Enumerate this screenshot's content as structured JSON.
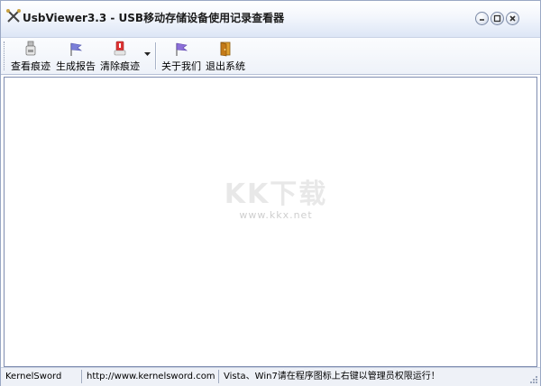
{
  "window": {
    "title": "UsbViewer3.3 - USB移动存储设备使用记录查看器",
    "app_icon": "crossed-tools-icon",
    "controls": [
      "minimize-icon",
      "maximize-icon",
      "close-icon"
    ]
  },
  "toolbar": {
    "buttons": [
      {
        "label": "查看痕迹",
        "icon": "usb-drive-icon"
      },
      {
        "label": "生成报告",
        "icon": "report-flag-icon"
      },
      {
        "label": "清除痕迹",
        "icon": "clear-trace-icon"
      },
      {
        "label": "关于我们",
        "icon": "about-flag-icon"
      },
      {
        "label": "退出系统",
        "icon": "exit-door-icon"
      }
    ]
  },
  "watermark": {
    "title": "KK下载",
    "url": "www.kkx.net"
  },
  "statusbar": {
    "author": "KernelSword",
    "website": "http://www.kernelsword.com",
    "message": "Vista、Win7请在程序图标上右键以管理员权限运行！"
  },
  "colors": {
    "titlebar_bottom": "#dde6f6",
    "toolbar_bg": "#eef2f9",
    "statusbar_bg": "#eef1f7",
    "border": "#7f8db0"
  }
}
